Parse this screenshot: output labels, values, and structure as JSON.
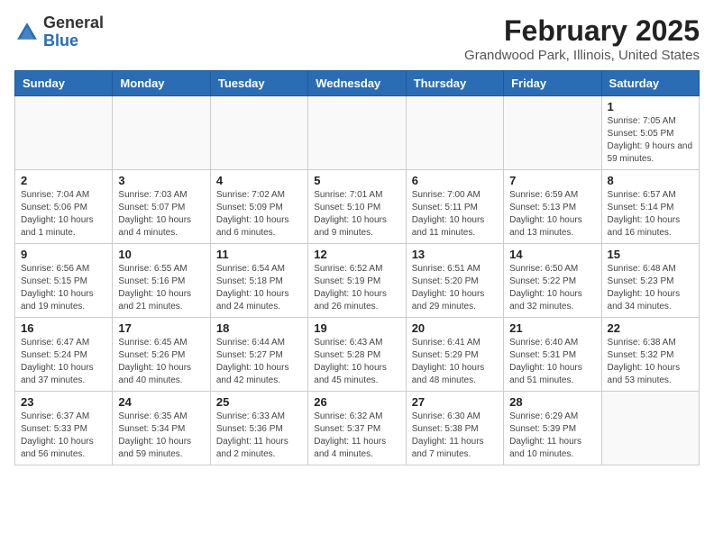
{
  "header": {
    "logo_general": "General",
    "logo_blue": "Blue",
    "month_title": "February 2025",
    "location": "Grandwood Park, Illinois, United States"
  },
  "days_of_week": [
    "Sunday",
    "Monday",
    "Tuesday",
    "Wednesday",
    "Thursday",
    "Friday",
    "Saturday"
  ],
  "weeks": [
    [
      {
        "day": "",
        "info": ""
      },
      {
        "day": "",
        "info": ""
      },
      {
        "day": "",
        "info": ""
      },
      {
        "day": "",
        "info": ""
      },
      {
        "day": "",
        "info": ""
      },
      {
        "day": "",
        "info": ""
      },
      {
        "day": "1",
        "info": "Sunrise: 7:05 AM\nSunset: 5:05 PM\nDaylight: 9 hours and 59 minutes."
      }
    ],
    [
      {
        "day": "2",
        "info": "Sunrise: 7:04 AM\nSunset: 5:06 PM\nDaylight: 10 hours and 1 minute."
      },
      {
        "day": "3",
        "info": "Sunrise: 7:03 AM\nSunset: 5:07 PM\nDaylight: 10 hours and 4 minutes."
      },
      {
        "day": "4",
        "info": "Sunrise: 7:02 AM\nSunset: 5:09 PM\nDaylight: 10 hours and 6 minutes."
      },
      {
        "day": "5",
        "info": "Sunrise: 7:01 AM\nSunset: 5:10 PM\nDaylight: 10 hours and 9 minutes."
      },
      {
        "day": "6",
        "info": "Sunrise: 7:00 AM\nSunset: 5:11 PM\nDaylight: 10 hours and 11 minutes."
      },
      {
        "day": "7",
        "info": "Sunrise: 6:59 AM\nSunset: 5:13 PM\nDaylight: 10 hours and 13 minutes."
      },
      {
        "day": "8",
        "info": "Sunrise: 6:57 AM\nSunset: 5:14 PM\nDaylight: 10 hours and 16 minutes."
      }
    ],
    [
      {
        "day": "9",
        "info": "Sunrise: 6:56 AM\nSunset: 5:15 PM\nDaylight: 10 hours and 19 minutes."
      },
      {
        "day": "10",
        "info": "Sunrise: 6:55 AM\nSunset: 5:16 PM\nDaylight: 10 hours and 21 minutes."
      },
      {
        "day": "11",
        "info": "Sunrise: 6:54 AM\nSunset: 5:18 PM\nDaylight: 10 hours and 24 minutes."
      },
      {
        "day": "12",
        "info": "Sunrise: 6:52 AM\nSunset: 5:19 PM\nDaylight: 10 hours and 26 minutes."
      },
      {
        "day": "13",
        "info": "Sunrise: 6:51 AM\nSunset: 5:20 PM\nDaylight: 10 hours and 29 minutes."
      },
      {
        "day": "14",
        "info": "Sunrise: 6:50 AM\nSunset: 5:22 PM\nDaylight: 10 hours and 32 minutes."
      },
      {
        "day": "15",
        "info": "Sunrise: 6:48 AM\nSunset: 5:23 PM\nDaylight: 10 hours and 34 minutes."
      }
    ],
    [
      {
        "day": "16",
        "info": "Sunrise: 6:47 AM\nSunset: 5:24 PM\nDaylight: 10 hours and 37 minutes."
      },
      {
        "day": "17",
        "info": "Sunrise: 6:45 AM\nSunset: 5:26 PM\nDaylight: 10 hours and 40 minutes."
      },
      {
        "day": "18",
        "info": "Sunrise: 6:44 AM\nSunset: 5:27 PM\nDaylight: 10 hours and 42 minutes."
      },
      {
        "day": "19",
        "info": "Sunrise: 6:43 AM\nSunset: 5:28 PM\nDaylight: 10 hours and 45 minutes."
      },
      {
        "day": "20",
        "info": "Sunrise: 6:41 AM\nSunset: 5:29 PM\nDaylight: 10 hours and 48 minutes."
      },
      {
        "day": "21",
        "info": "Sunrise: 6:40 AM\nSunset: 5:31 PM\nDaylight: 10 hours and 51 minutes."
      },
      {
        "day": "22",
        "info": "Sunrise: 6:38 AM\nSunset: 5:32 PM\nDaylight: 10 hours and 53 minutes."
      }
    ],
    [
      {
        "day": "23",
        "info": "Sunrise: 6:37 AM\nSunset: 5:33 PM\nDaylight: 10 hours and 56 minutes."
      },
      {
        "day": "24",
        "info": "Sunrise: 6:35 AM\nSunset: 5:34 PM\nDaylight: 10 hours and 59 minutes."
      },
      {
        "day": "25",
        "info": "Sunrise: 6:33 AM\nSunset: 5:36 PM\nDaylight: 11 hours and 2 minutes."
      },
      {
        "day": "26",
        "info": "Sunrise: 6:32 AM\nSunset: 5:37 PM\nDaylight: 11 hours and 4 minutes."
      },
      {
        "day": "27",
        "info": "Sunrise: 6:30 AM\nSunset: 5:38 PM\nDaylight: 11 hours and 7 minutes."
      },
      {
        "day": "28",
        "info": "Sunrise: 6:29 AM\nSunset: 5:39 PM\nDaylight: 11 hours and 10 minutes."
      },
      {
        "day": "",
        "info": ""
      }
    ]
  ]
}
